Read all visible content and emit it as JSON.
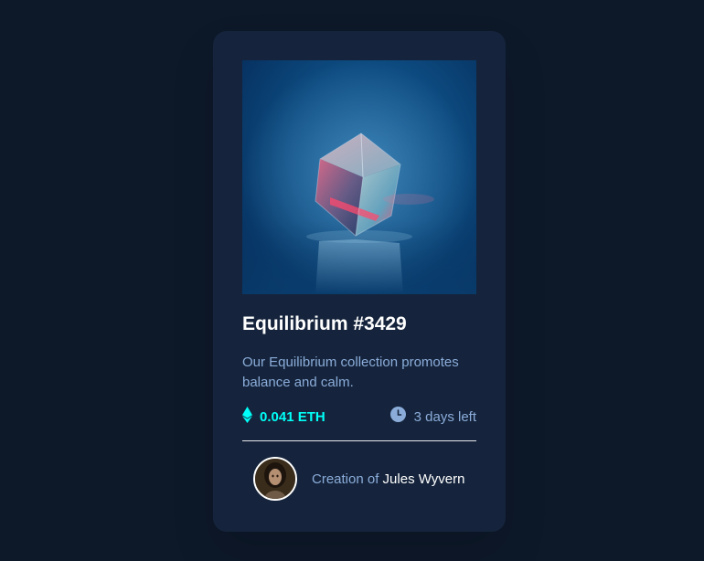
{
  "card": {
    "title": "Equilibrium #3429",
    "description": "Our Equilibrium collection promotes balance and calm.",
    "price": "0.041 ETH",
    "time_left": "3 days left",
    "creator_prefix": "Creation of",
    "creator_name": "Jules Wyvern"
  },
  "icons": {
    "price": "ethereum-icon",
    "time": "clock-icon"
  },
  "colors": {
    "page_background": "#0d1829",
    "card_background": "#15243c",
    "accent_cyan": "#00fff8",
    "soft_blue": "#8bacd9",
    "white": "#ffffff"
  }
}
